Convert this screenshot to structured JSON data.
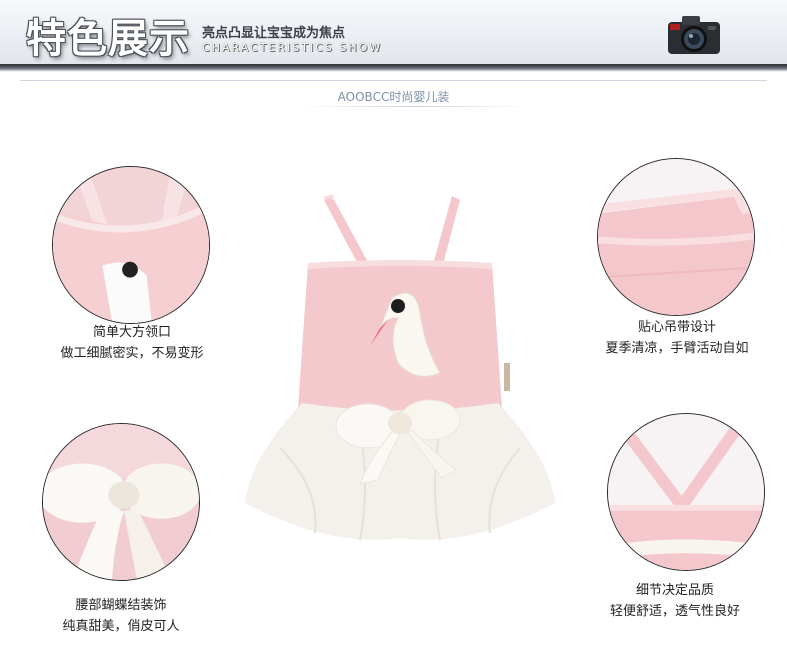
{
  "header": {
    "title": "特色展示",
    "subtitle_cn": "亮点凸显让宝宝成为焦点",
    "subtitle_en": "CHARACTERISTICS SHOW",
    "camera_icon": "camera-icon"
  },
  "brand": {
    "text": "AOOBCC时尚婴儿装"
  },
  "features": [
    {
      "line1": "简单大方领口",
      "line2": "做工细腻密实，不易变形"
    },
    {
      "line1": "贴心吊带设计",
      "line2": "夏季清凉，手臂活动自如"
    },
    {
      "line1": "腰部蝴蝶结装饰",
      "line2": "纯真甜美，俏皮可人"
    },
    {
      "line1": "细节决定品质",
      "line2": "轻便舒适，透气性良好"
    }
  ],
  "colors": {
    "pink": "#f4c9cd",
    "tulle": "#f4f1ec",
    "caption_text": "#222222",
    "brand_text": "#7d8fa8"
  }
}
